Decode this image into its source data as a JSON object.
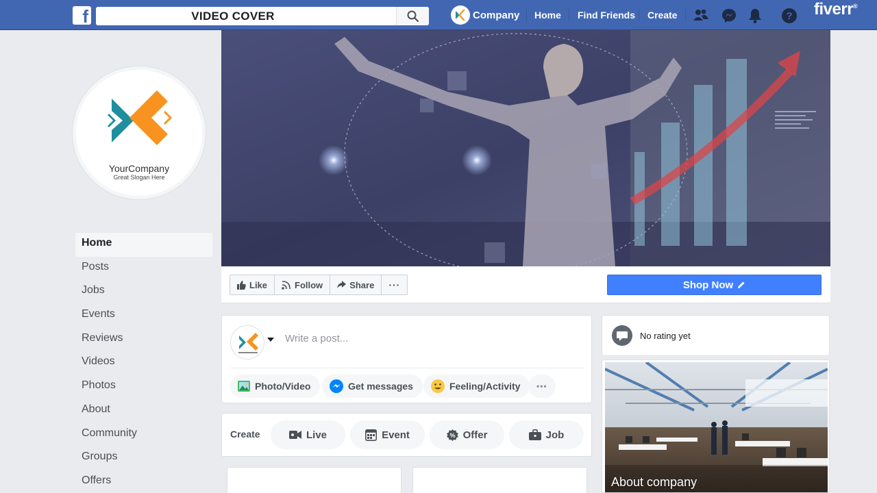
{
  "topbar": {
    "search_text": "VIDEO COVER",
    "brand_name": "Company",
    "nav": [
      "Home",
      "Find Friends",
      "Create"
    ],
    "watermark": "fiverr",
    "watermark_mark": "®"
  },
  "profile": {
    "company_name": "YourCompany",
    "slogan": "Great Slogan Here"
  },
  "sidebar": {
    "items": [
      {
        "label": "Home",
        "active": true
      },
      {
        "label": "Posts"
      },
      {
        "label": "Jobs"
      },
      {
        "label": "Events"
      },
      {
        "label": "Reviews"
      },
      {
        "label": "Videos"
      },
      {
        "label": "Photos"
      },
      {
        "label": "About"
      },
      {
        "label": "Community"
      },
      {
        "label": "Groups"
      },
      {
        "label": "Offers"
      }
    ]
  },
  "actions": {
    "like": "Like",
    "follow": "Follow",
    "share": "Share",
    "more": "···",
    "shop_now": "Shop Now"
  },
  "composer": {
    "placeholder": "Write a post...",
    "photo_video": "Photo/Video",
    "get_messages": "Get messages",
    "feeling": "Feeling/Activity",
    "more": "•••"
  },
  "create": {
    "label": "Create",
    "live": "Live",
    "event": "Event",
    "offer": "Offer",
    "job": "Job"
  },
  "right": {
    "rating_text": "No rating yet",
    "about_label": "About company"
  },
  "colors": {
    "topbar": "#4267b2",
    "shop_button": "#4080ff",
    "logo_teal": "#1f8f9f",
    "logo_orange": "#f7931e"
  }
}
